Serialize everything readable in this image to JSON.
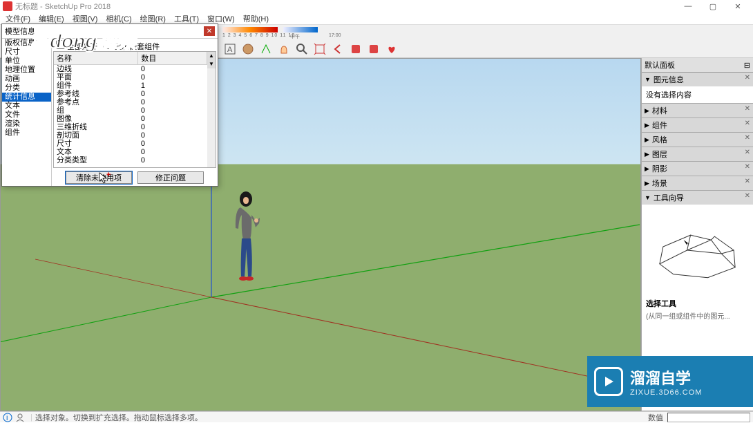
{
  "window": {
    "title": "无标题 - SketchUp Pro 2018",
    "min": "—",
    "max": "▢",
    "close": "✕"
  },
  "menu": {
    "file": "文件(F)",
    "edit": "编辑(E)",
    "view": "视图(V)",
    "camera": "相机(C)",
    "draw": "绘图(R)",
    "tools": "工具(T)",
    "window": "窗口(W)",
    "help": "帮助(H)"
  },
  "toolbar": {
    "scale_numbers": "1 2 3 4 5 6 7 8 9 10 11 12",
    "noon": "中午",
    "time": "17:00"
  },
  "dialog": {
    "title": "模型信息",
    "check_all": "全部展开",
    "check_nested": "显示嵌套组件",
    "left_items": [
      "版权信息",
      "尺寸",
      "单位",
      "地理位置",
      "动画",
      "分类",
      "统计信息",
      "文本",
      "文件",
      "渲染",
      "组件"
    ],
    "selected_index": 6,
    "col_name": "名称",
    "col_count": "数目",
    "rows": [
      {
        "name": "边线",
        "count": "0"
      },
      {
        "name": "平面",
        "count": "0"
      },
      {
        "name": "组件",
        "count": "1"
      },
      {
        "name": "参考线",
        "count": "0"
      },
      {
        "name": "参考点",
        "count": "0"
      },
      {
        "name": "组",
        "count": "0"
      },
      {
        "name": "图像",
        "count": "0"
      },
      {
        "name": "三维折线",
        "count": "0"
      },
      {
        "name": "剖切面",
        "count": "0"
      },
      {
        "name": "尺寸",
        "count": "0"
      },
      {
        "name": "文本",
        "count": "0"
      },
      {
        "name": "分类类型",
        "count": "0"
      }
    ],
    "btn_purge": "清除未使用项",
    "btn_fix": "修正问题"
  },
  "tray": {
    "header": "默认面板",
    "entity": {
      "head": "图元信息",
      "body": "没有选择内容"
    },
    "panels": [
      "材料",
      "组件",
      "风格",
      "图层",
      "阴影",
      "场景"
    ],
    "instructor_head": "工具向导",
    "instructor_title": "选择工具",
    "instructor_hint": "(从同一组或组件中的图元..."
  },
  "status": {
    "hint": "选择对象。切换到扩充选择。拖动鼠标选择多项。",
    "measure_label": "数值"
  },
  "watermark": "秒dong视频",
  "brand": {
    "big": "溜溜自学",
    "small": "ZIXUE.3D66.COM"
  }
}
